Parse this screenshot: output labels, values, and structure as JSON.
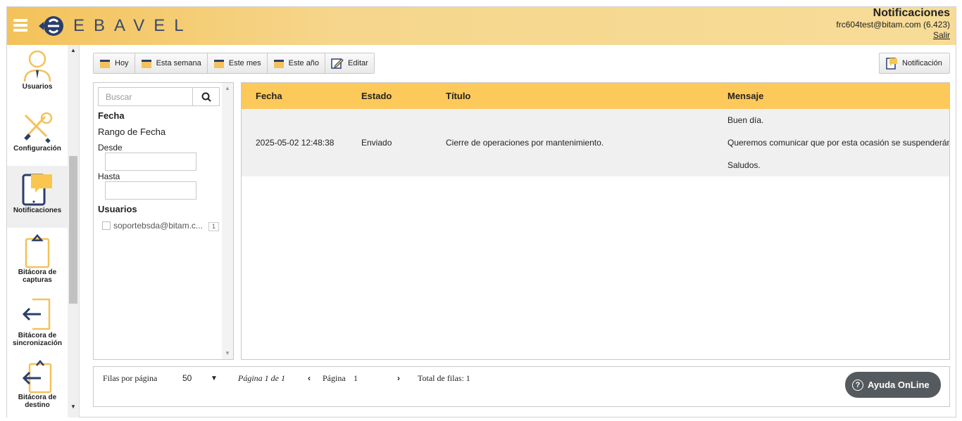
{
  "header": {
    "logo_text": "EBAVEL",
    "title": "Notificaciones",
    "user": "frc604test@bitam.com  (6.423)",
    "logout": "Salir"
  },
  "sidebar": {
    "items": [
      {
        "label": "Usuarios",
        "icon": "user-icon"
      },
      {
        "label": "Configuración",
        "icon": "tools-icon"
      },
      {
        "label": "Notificaciones",
        "icon": "tablet-notification-icon",
        "active": true
      },
      {
        "label": "Bitácora de capturas",
        "icon": "clipboard-icon"
      },
      {
        "label": "Bitácora de sincronización",
        "icon": "sync-log-icon"
      },
      {
        "label": "Bitácora de destino",
        "icon": "destination-log-icon"
      }
    ]
  },
  "toolbar": {
    "hoy": "Hoy",
    "esta_semana": "Esta semana",
    "este_mes": "Este mes",
    "este_anio": "Este año",
    "editar": "Editar",
    "notificacion": "Notificación"
  },
  "filter": {
    "search_placeholder": "Buscar",
    "fecha": "Fecha",
    "rango": "Rango de Fecha",
    "desde": "Desde",
    "hasta": "Hasta",
    "usuarios": "Usuarios",
    "user_option": "soportebsda@bitam.c...",
    "user_count": "1"
  },
  "grid": {
    "columns": [
      "Fecha",
      "Estado",
      "Título",
      "Mensaje"
    ],
    "rows": [
      {
        "fecha": "2025-05-02 12:48:38",
        "estado": "Enviado",
        "titulo": "Cierre de operaciones por mantenimiento.",
        "mensaje_1": "Buen día.",
        "mensaje_2": "Queremos comunicar que por esta ocasión se suspenderán",
        "mensaje_3": "Saludos."
      }
    ]
  },
  "pager": {
    "rows_per_page_label": "Filas por página",
    "rows_per_page": "50",
    "page_of": "Página 1 de 1",
    "page_label": "Página",
    "page_value": "1",
    "total": "Total de filas: 1"
  },
  "help": {
    "label": "Ayuda OnLine"
  },
  "colors": {
    "header_accent": "#f3c25a",
    "grid_header": "#fdc95a",
    "brand_navy": "#2b3e6b"
  }
}
